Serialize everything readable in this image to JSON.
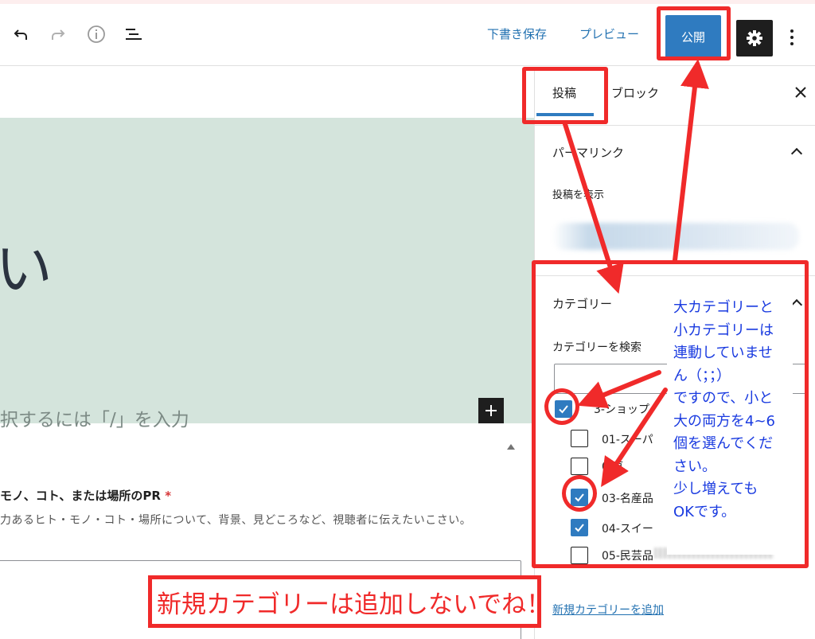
{
  "toolbar": {
    "save_draft": "下書き保存",
    "preview": "プレビュー",
    "publish": "公開",
    "icons": [
      "undo-icon",
      "redo-icon",
      "info-icon",
      "list-view-icon",
      "gear-icon",
      "more-icon"
    ]
  },
  "editor": {
    "cover_title": "い",
    "block_placeholder": "択するには「/」を入力",
    "field_label": "モノ、コト、または場所のPR",
    "field_required": "*",
    "field_help": "力あるヒト・モノ・コト・場所について、背景、見どころなど、視聴者に伝えたいこさい。"
  },
  "sidebar": {
    "tabs": [
      "投稿",
      "ブロック"
    ],
    "permalink": {
      "title": "パーマリンク",
      "view_post": "投稿を表示"
    },
    "categories": {
      "title": "カテゴリー",
      "search_label": "カテゴリーを検索",
      "items": [
        {
          "label": "3-ショップ",
          "checked": true
        },
        {
          "label": "01-スーパ",
          "checked": false
        },
        {
          "label": "0 直",
          "checked": false
        },
        {
          "label": "03-名産品",
          "checked": true
        },
        {
          "label": "04-スイー",
          "checked": true
        },
        {
          "label": "05-民芸品",
          "checked": false
        }
      ],
      "add_new": "新規カテゴリーを追加"
    }
  },
  "annotations": {
    "blue_note": [
      "大カテゴリーと",
      "小カテゴリーは",
      "連動していませ",
      "ん（；；）",
      "ですので、小と",
      "大の両方を4~6",
      "個を選んでくだ",
      "さい。",
      "少し増えても",
      "OKです。"
    ],
    "red_note": "新規カテゴリーは追加しないでね！",
    "colors": {
      "red": "#f02a2a",
      "blue": "#1a3be0",
      "wp_blue": "#2f7bc0"
    }
  }
}
